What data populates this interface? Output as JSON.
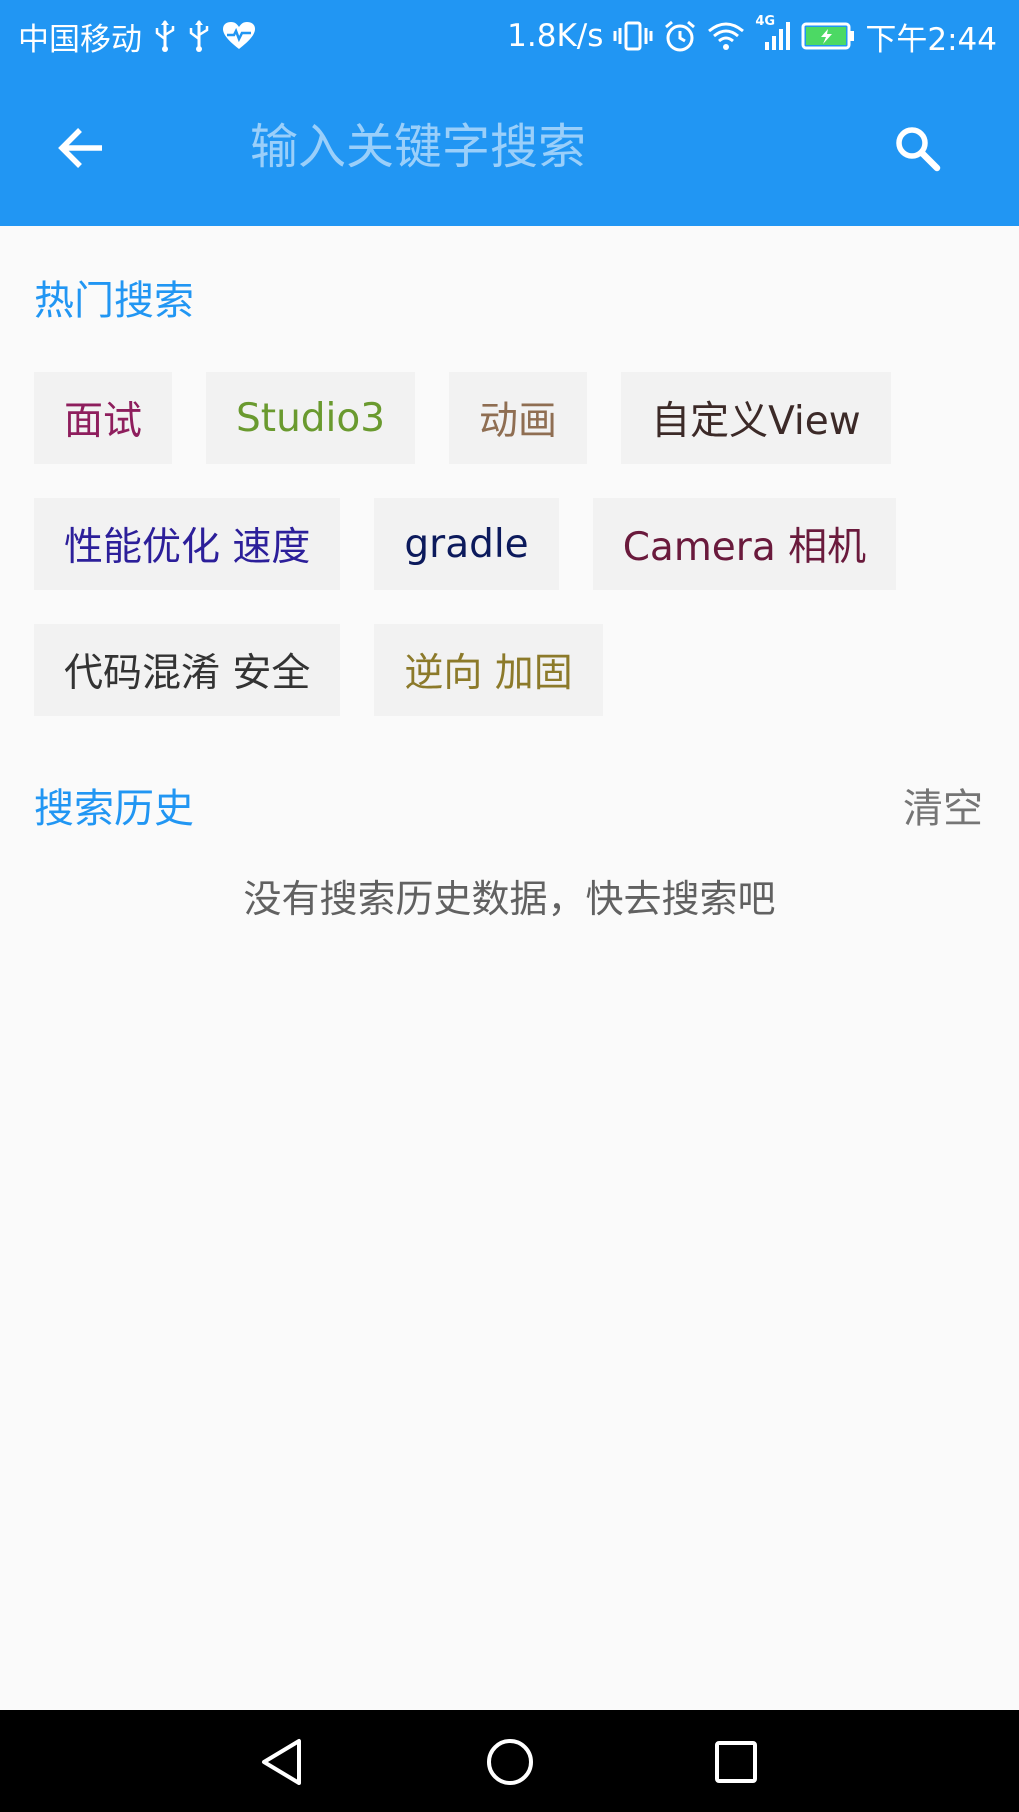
{
  "status_bar": {
    "carrier": "中国移动",
    "net_speed": "1.8K/s",
    "network_badge": "4G",
    "time": "下午2:44",
    "icons": [
      "usb-icon",
      "usb-icon",
      "heart-rate-icon",
      "vibrate-icon",
      "alarm-icon",
      "wifi-icon",
      "signal-icon",
      "battery-charging-icon"
    ]
  },
  "toolbar": {
    "back_icon": "arrow-left-icon",
    "search_placeholder": "输入关键字搜索",
    "search_value": "",
    "search_icon": "search-icon"
  },
  "hot_search": {
    "title": "热门搜索",
    "tags": [
      {
        "label": "面试",
        "color": "#8e1e5d"
      },
      {
        "label": "Studio3",
        "color": "#6a9a2f"
      },
      {
        "label": "动画",
        "color": "#8f6e52"
      },
      {
        "label": "自定义View",
        "color": "#3c2a28"
      },
      {
        "label": "性能优化 速度",
        "color": "#2c1f9a"
      },
      {
        "label": "gradle",
        "color": "#0c1a5c"
      },
      {
        "label": "Camera 相机",
        "color": "#6a1a3c"
      },
      {
        "label": "代码混淆 安全",
        "color": "#333333"
      },
      {
        "label": "逆向 加固",
        "color": "#8c7a2a"
      }
    ]
  },
  "history": {
    "title": "搜索历史",
    "clear_label": "清空",
    "empty_text": "没有搜索历史数据，快去搜索吧"
  },
  "nav_bar": {
    "buttons": [
      "back-triangle-icon",
      "home-circle-icon",
      "recent-square-icon"
    ]
  },
  "colors": {
    "primary": "#2196f3",
    "background": "#fafafa",
    "tag_background": "#f2f2f2"
  }
}
